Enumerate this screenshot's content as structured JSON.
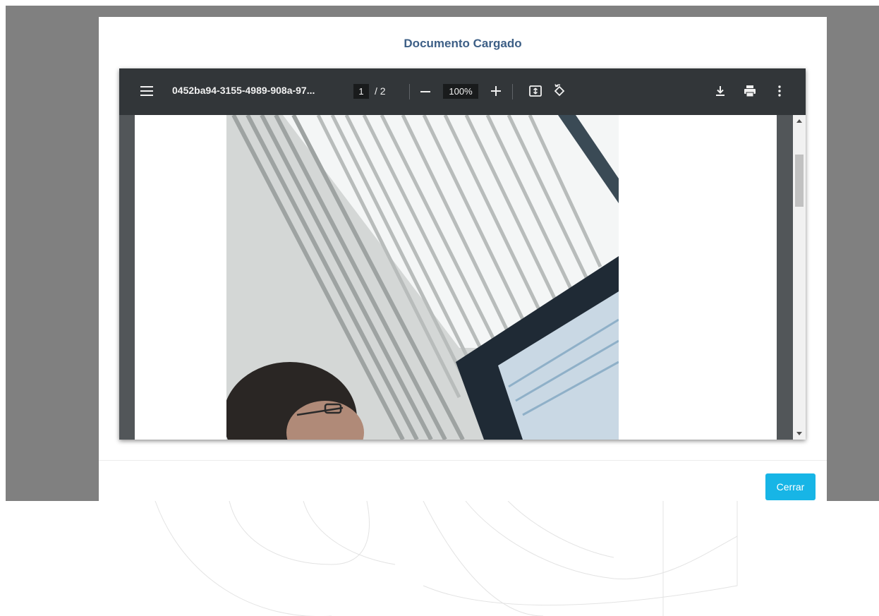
{
  "modal": {
    "title": "Documento Cargado",
    "close_label": "Cerrar"
  },
  "viewer": {
    "file_name": "0452ba94-3155-4989-908a-97...",
    "current_page": "1",
    "total_pages": "/ 2",
    "zoom": "100%",
    "icons": [
      "menu-icon",
      "zoom-out-icon",
      "zoom-in-icon",
      "fit-page-icon",
      "rotate-icon",
      "download-icon",
      "print-icon",
      "more-options-icon"
    ]
  },
  "colors": {
    "title": "#3d5f86",
    "close_button": "#17b5e6",
    "toolbar": "#323639",
    "viewer_bg": "#525659",
    "overlay": "#808080"
  }
}
